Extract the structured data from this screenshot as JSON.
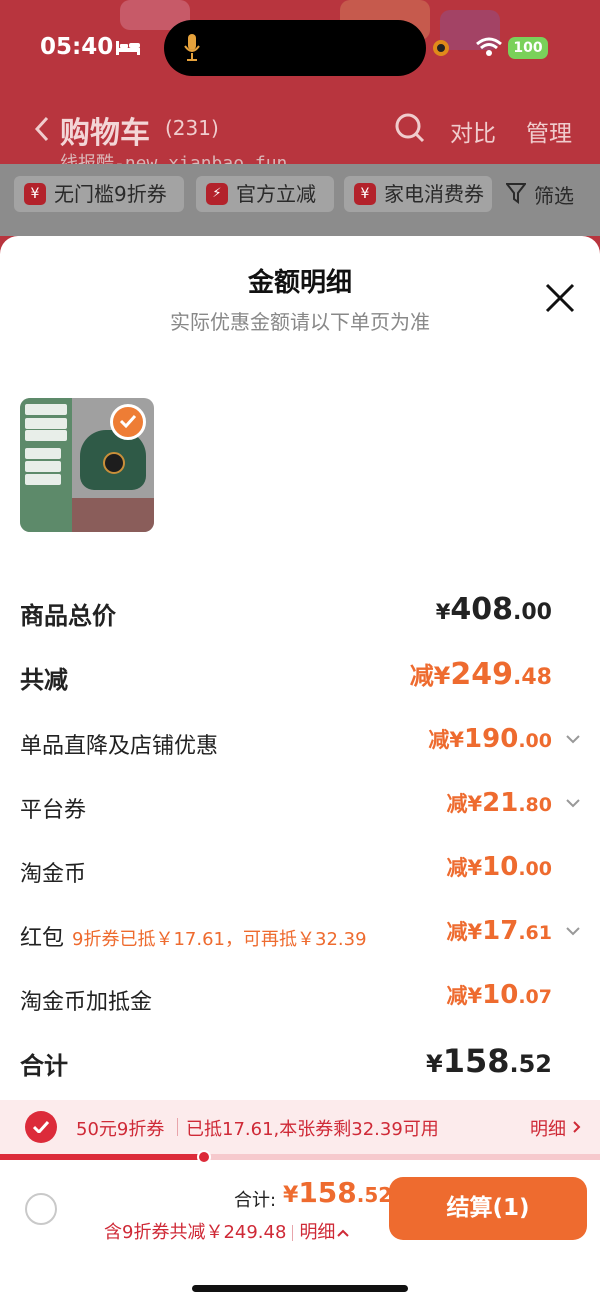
{
  "status_bar": {
    "time": "05:40",
    "battery": "100"
  },
  "nav": {
    "title": "购物车",
    "count": "(231)",
    "compare": "对比",
    "manage": "管理",
    "watermark": "线报酷-new.xianbao.fun"
  },
  "filters": {
    "chips": [
      "无门槛9折券",
      "官方立减",
      "家电消费券"
    ],
    "filter_label": "筛选"
  },
  "sheet": {
    "title": "金额明细",
    "subtitle": "实际优惠金额请以下单页为准",
    "thumbnail_text": [
      "迷你饭煲",
      "适用1-2人",
      "1.8L小容量",
      "不粘内胆",
      "旋转旋钮",
      "自动控压",
      "SUPOR"
    ],
    "rows": [
      {
        "label": "商品总价",
        "prefix": "¥",
        "integer": "408",
        "decimal": ".00"
      },
      {
        "label": "共减",
        "prefix": "减¥",
        "integer": "249",
        "decimal": ".48"
      },
      {
        "label": "单品直降及店铺优惠",
        "prefix": "减¥",
        "integer": "190",
        "decimal": ".00"
      },
      {
        "label": "平台券",
        "prefix": "减¥",
        "integer": "21",
        "decimal": ".80"
      },
      {
        "label": "淘金币",
        "prefix": "减¥",
        "integer": "10",
        "decimal": ".00"
      },
      {
        "label": "红包",
        "note": "9折券已抵￥17.61，可再抵￥32.39",
        "prefix": "减¥",
        "integer": "17",
        "decimal": ".61"
      },
      {
        "label": "淘金币加抵金",
        "prefix": "减¥",
        "integer": "10",
        "decimal": ".07"
      },
      {
        "label": "合计",
        "prefix": "¥",
        "integer": "158",
        "decimal": ".52"
      }
    ]
  },
  "coupon_bar": {
    "name": "50元9折券",
    "info": "已抵17.61,本张券剩32.39可用",
    "detail": "明细",
    "progress": 0.34
  },
  "checkout": {
    "total_label": "合计:",
    "total_prefix": "¥",
    "total_integer": "158",
    "total_decimal": ".52",
    "saving_text": "含9折券共减￥249.48",
    "detail_link": "明细",
    "button_label": "结算(1)"
  },
  "colors": {
    "accent_orange": "#ee6b2f",
    "coupon_red": "#dc2b3a",
    "header_red": "#b8353e"
  }
}
